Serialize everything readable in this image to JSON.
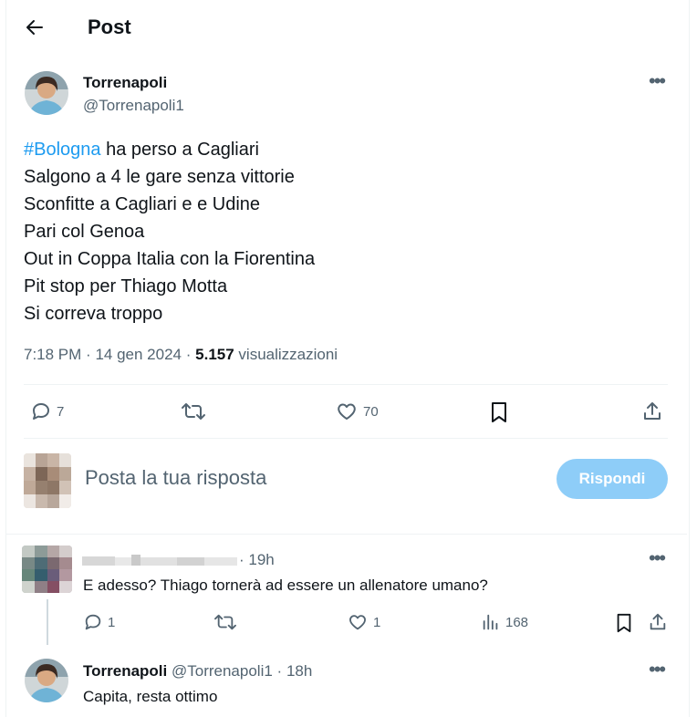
{
  "header": {
    "title": "Post"
  },
  "post": {
    "author_name": "Torrenapoli",
    "author_handle": "@Torrenapoli1",
    "hashtag": "#Bologna",
    "line1_rest": " ha perso a Cagliari",
    "lines": [
      "Salgono a 4 le gare senza vittorie",
      "Sconfitte a Cagliari e e Udine",
      "Pari col Genoa",
      "Out in Coppa Italia con la Fiorentina",
      "Pit stop per Thiago Motta",
      "Si correva troppo"
    ],
    "time": "7:18 PM",
    "date": "14 gen 2024",
    "sep": "·",
    "views_count": "5.157",
    "views_label": "visualizzazioni",
    "replies": "7",
    "likes": "70"
  },
  "composer": {
    "placeholder": "Posta la tua risposta",
    "button_label": "Rispondi"
  },
  "reply1": {
    "time": "19h",
    "text": "E adesso? Thiago tornerà ad essere un allenatore umano?",
    "replies": "1",
    "likes": "1",
    "views": "168"
  },
  "reply2": {
    "author_name": "Torrenapoli",
    "author_handle": "@Torrenapoli1",
    "time": "18h",
    "text": "Capita, resta ottimo"
  },
  "colors": {
    "accent": "#1d9bf0",
    "hashtag": "#1d9bf0",
    "button_disabled": "#8ecdf8",
    "muted": "#536471",
    "divider": "#eff3f4"
  },
  "icons": [
    "back-arrow-icon",
    "more-icon",
    "reply-icon",
    "retweet-icon",
    "like-icon",
    "bookmark-icon",
    "share-icon",
    "views-icon"
  ]
}
